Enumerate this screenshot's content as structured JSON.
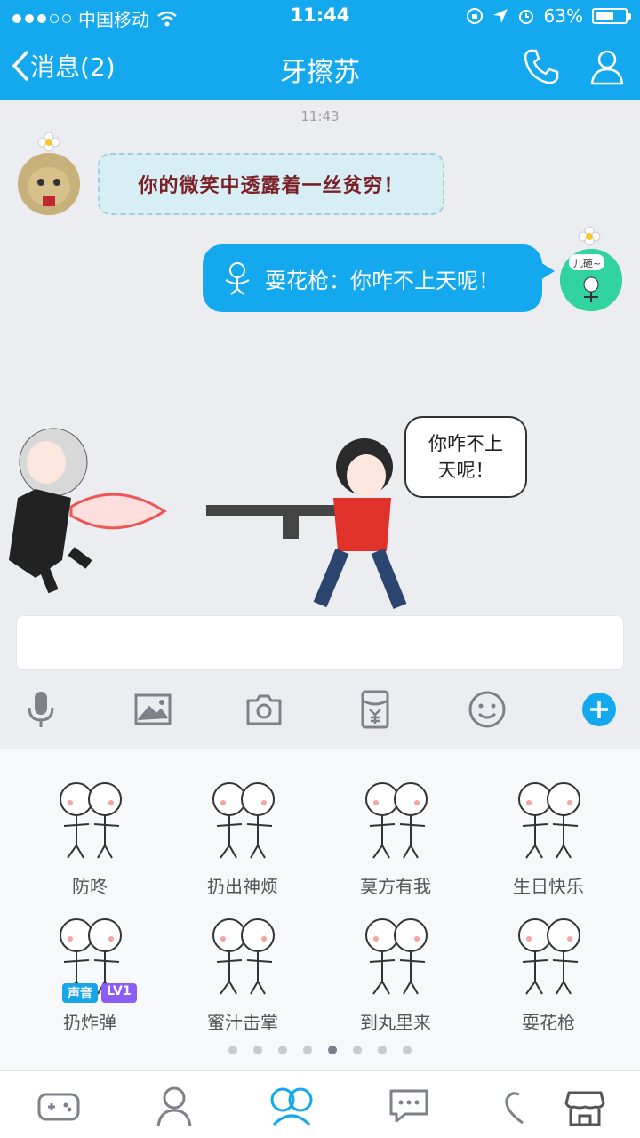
{
  "status_bar": {
    "carrier": "中国移动",
    "time": "11:44",
    "battery": "63%",
    "battery_level": 0.63
  },
  "navbar": {
    "back_label": "消息(2)",
    "title": "牙擦苏",
    "icons": [
      "phone-icon",
      "profile-icon"
    ]
  },
  "chat": {
    "timestamp": "11:43",
    "messages": [
      {
        "side": "left",
        "text": "你的微笑中透露着一丝贫穷！"
      },
      {
        "side": "right",
        "text": "耍花枪：你咋不上天呢！"
      }
    ],
    "scene_speech": [
      "你咋不上",
      "天呢！"
    ],
    "right_avatar_text": "儿砸~"
  },
  "input": {
    "placeholder": ""
  },
  "toolbar": {
    "icons": [
      "microphone-icon",
      "image-icon",
      "camera-icon",
      "red-packet-icon",
      "emoji-icon",
      "plus-icon"
    ]
  },
  "stickers": [
    {
      "label": "防咚"
    },
    {
      "label": "扔出神烦"
    },
    {
      "label": "莫方有我"
    },
    {
      "label": "生日快乐"
    },
    {
      "label": "扔炸弹"
    },
    {
      "label": "蜜汁击掌"
    },
    {
      "label": "到丸里来"
    },
    {
      "label": "耍花枪"
    }
  ],
  "sticker_badges": {
    "sound": "声音",
    "level": "LV1"
  },
  "pager": {
    "count": 8,
    "active": 4
  },
  "bottom_bar": {
    "icons": [
      "game-icon",
      "avatar-icon",
      "emoticon-icon",
      "chat-bubble-icon",
      "heart-icon",
      "store-icon"
    ]
  },
  "colors": {
    "brand": "#14a9ef",
    "background": "#ebedf1"
  }
}
